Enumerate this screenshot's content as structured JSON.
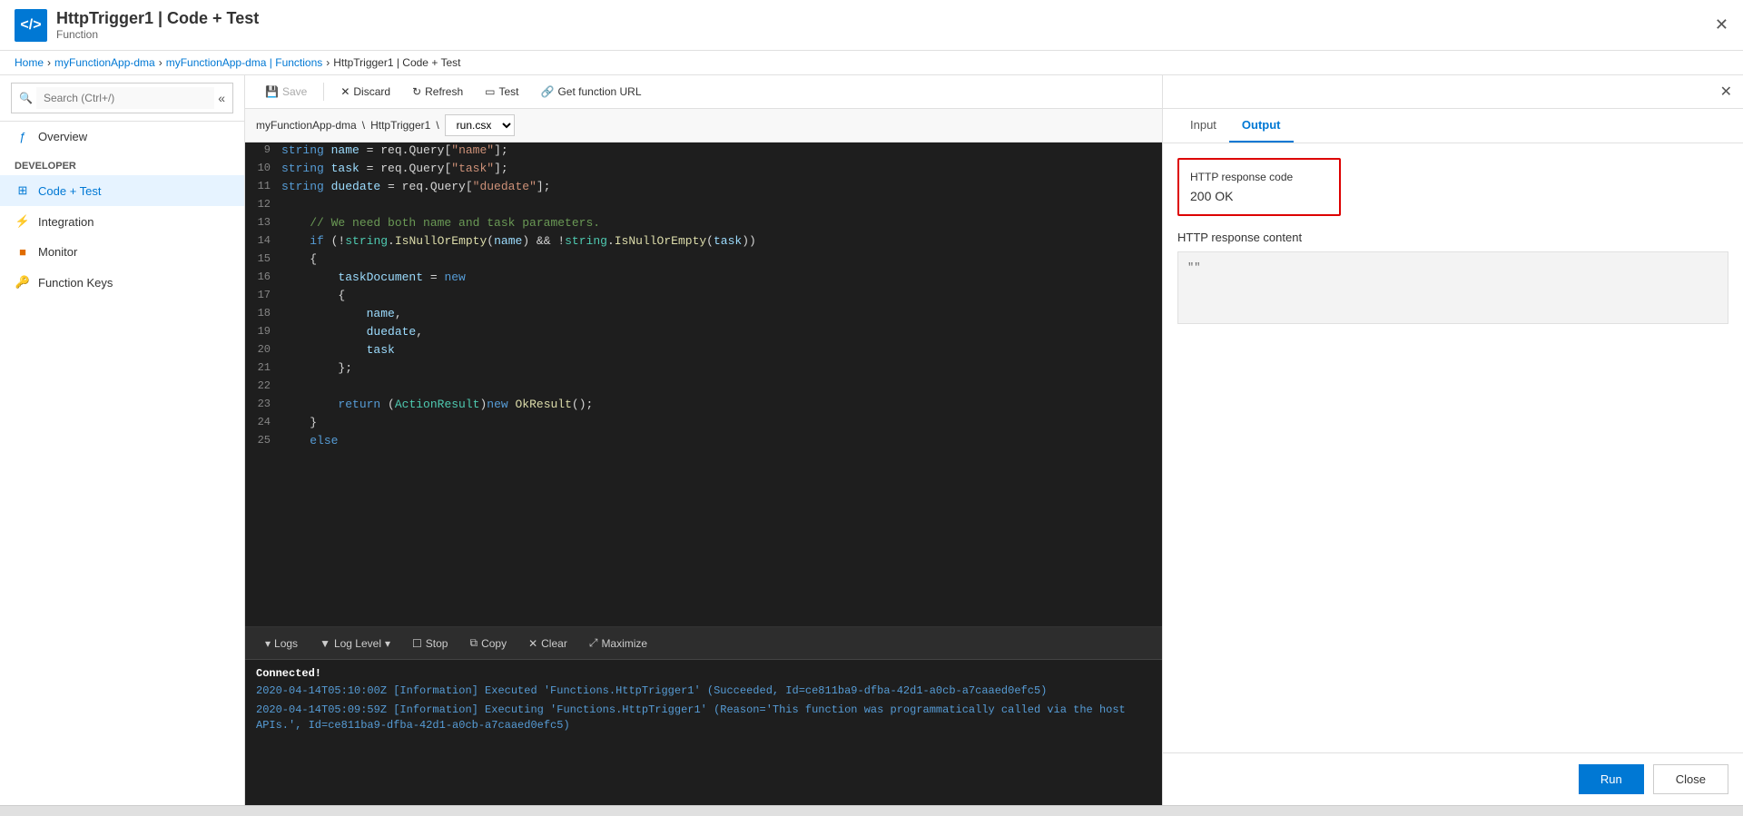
{
  "topBar": {
    "icon": "</>",
    "title": "HttpTrigger1 | Code + Test",
    "subtitle": "Function"
  },
  "breadcrumb": {
    "items": [
      "Home",
      "myFunctionApp-dma",
      "myFunctionApp-dma | Functions",
      "HttpTrigger1 | Code + Test"
    ]
  },
  "sidebar": {
    "searchPlaceholder": "Search (Ctrl+/)",
    "collapseIcon": "«",
    "overviewLabel": "Overview",
    "developerLabel": "Developer",
    "items": [
      {
        "id": "overview",
        "label": "Overview",
        "icon": "ƒ"
      },
      {
        "id": "code-test",
        "label": "Code + Test",
        "icon": "⊞",
        "active": true
      },
      {
        "id": "integration",
        "label": "Integration",
        "icon": "⚡"
      },
      {
        "id": "monitor",
        "label": "Monitor",
        "icon": "📊"
      },
      {
        "id": "function-keys",
        "label": "Function Keys",
        "icon": "🔑"
      }
    ]
  },
  "toolbar": {
    "saveLabel": "Save",
    "discardLabel": "Discard",
    "refreshLabel": "Refresh",
    "testLabel": "Test",
    "getFunctionUrlLabel": "Get function URL"
  },
  "filePath": {
    "appName": "myFunctionApp-dma",
    "functionName": "HttpTrigger1",
    "fileName": "run.csx"
  },
  "codeLines": [
    {
      "num": 9,
      "content": "    string name = req.Query[\"name\"];"
    },
    {
      "num": 10,
      "content": "    string task = req.Query[\"task\"];"
    },
    {
      "num": 11,
      "content": "    string duedate = req.Query[\"duedate\"];"
    },
    {
      "num": 12,
      "content": ""
    },
    {
      "num": 13,
      "content": "    // We need both name and task parameters."
    },
    {
      "num": 14,
      "content": "    if (!string.IsNullOrEmpty(name) && !string.IsNullOrEmpty(task))"
    },
    {
      "num": 15,
      "content": "    {"
    },
    {
      "num": 16,
      "content": "        taskDocument = new"
    },
    {
      "num": 17,
      "content": "        {"
    },
    {
      "num": 18,
      "content": "            name,"
    },
    {
      "num": 19,
      "content": "            duedate,"
    },
    {
      "num": 20,
      "content": "            task"
    },
    {
      "num": 21,
      "content": "        };"
    },
    {
      "num": 22,
      "content": ""
    },
    {
      "num": 23,
      "content": "        return (ActionResult)new OkResult();"
    },
    {
      "num": 24,
      "content": "    }"
    },
    {
      "num": 25,
      "content": "    else"
    }
  ],
  "logs": {
    "toolbar": {
      "logsLabel": "Logs",
      "logLevelLabel": "Log Level",
      "stopLabel": "Stop",
      "copyLabel": "Copy",
      "clearLabel": "Clear",
      "maximizeLabel": "Maximize"
    },
    "connected": "Connected!",
    "entries": [
      "2020-04-14T05:10:00Z  [Information]  Executed 'Functions.HttpTrigger1' (Succeeded, Id=ce811ba9-dfba-42d1-a0cb-a7caaed0efc5)",
      "2020-04-14T05:09:59Z  [Information]  Executing 'Functions.HttpTrigger1' (Reason='This function was programmatically called via the host APIs.', Id=ce811ba9-dfba-42d1-a0cb-a7caaed0efc5)"
    ]
  },
  "rightPanel": {
    "tabs": [
      "Input",
      "Output"
    ],
    "activeTab": "Output",
    "httpResponseCode": {
      "label": "HTTP response code",
      "value": "200 OK"
    },
    "httpResponseContent": {
      "label": "HTTP response content",
      "value": "\"\""
    },
    "runLabel": "Run",
    "closeLabel": "Close"
  }
}
